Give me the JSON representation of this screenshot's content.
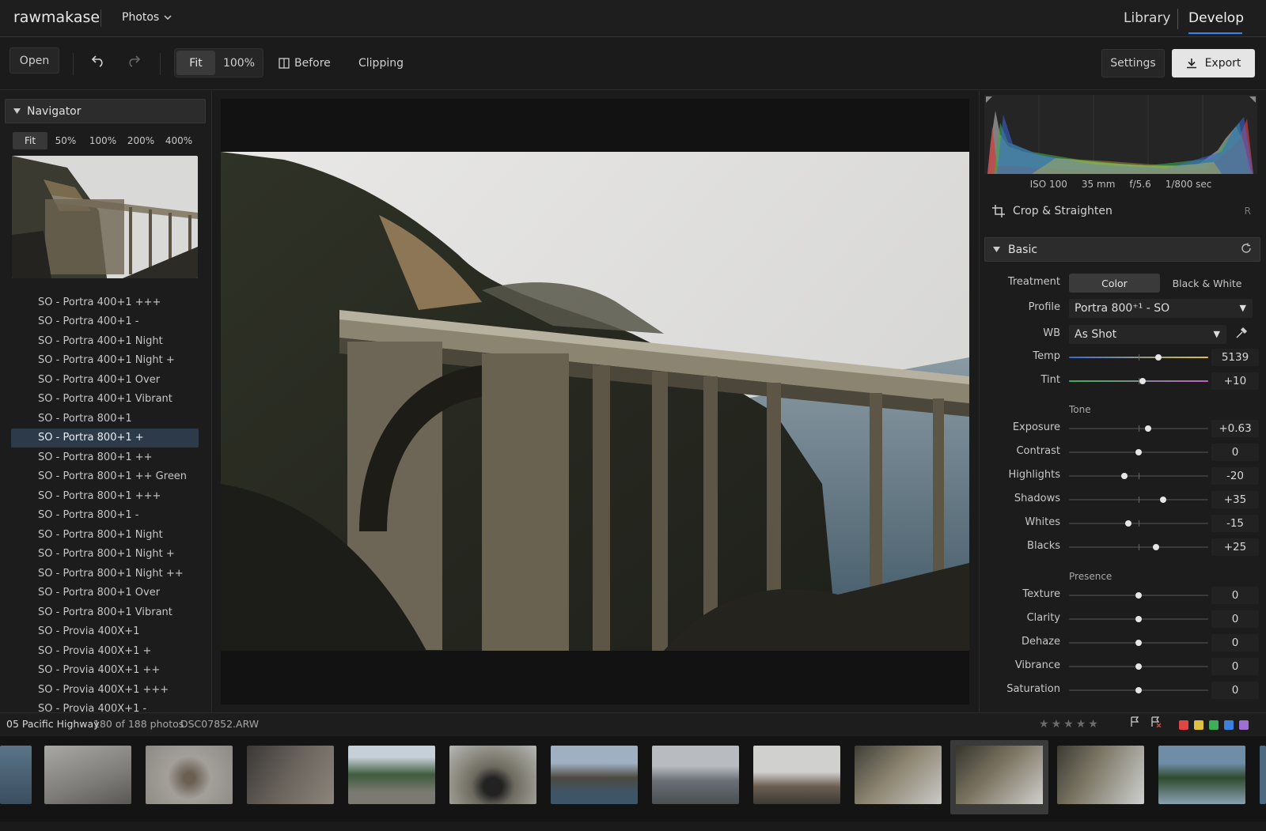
{
  "app": {
    "brand": "rawmakase",
    "album_dropdown": "Photos",
    "modes": [
      "Library",
      "Develop"
    ],
    "active_mode": "Develop"
  },
  "toolbar": {
    "open": "Open",
    "fit": "Fit",
    "zoom100": "100%",
    "before": "Before",
    "clipping": "Clipping",
    "settings": "Settings",
    "export": "Export"
  },
  "navigator": {
    "title": "Navigator",
    "zoom_levels": [
      "Fit",
      "50%",
      "100%",
      "200%",
      "400%"
    ],
    "active_zoom": "Fit"
  },
  "presets": [
    "SO - Portra 400+1 +++",
    "SO - Portra 400+1 -",
    "SO - Portra 400+1 Night",
    "SO - Portra 400+1 Night +",
    "SO - Portra 400+1 Over",
    "SO - Portra 400+1 Vibrant",
    "SO - Portra 800+1",
    "SO - Portra 800+1 +",
    "SO - Portra 800+1 ++",
    "SO - Portra 800+1 ++ Green",
    "SO - Portra 800+1 +++",
    "SO - Portra 800+1 -",
    "SO - Portra 800+1 Night",
    "SO - Portra 800+1 Night +",
    "SO - Portra 800+1 Night ++",
    "SO - Portra 800+1 Over",
    "SO - Portra 800+1 Vibrant",
    "SO - Provia 400X+1",
    "SO - Provia 400X+1 +",
    "SO - Provia 400X+1 ++",
    "SO - Provia 400X+1 +++",
    "SO - Provia 400X+1 -"
  ],
  "selected_preset": "SO - Portra 800+1 +",
  "exif": {
    "iso": "ISO 100",
    "focal": "35 mm",
    "aperture": "f/5.6",
    "shutter": "1/800 sec"
  },
  "crop": {
    "label": "Crop & Straighten",
    "shortcut": "R"
  },
  "basic": {
    "title": "Basic",
    "treatment_label": "Treatment",
    "treatment_options": [
      "Color",
      "Black & White"
    ],
    "treatment_selected": "Color",
    "profile_label": "Profile",
    "profile_value": "Portra 800⁺¹ - SO",
    "wb_label": "WB",
    "wb_value": "As Shot",
    "tone_section": "Tone",
    "presence_section": "Presence",
    "sliders": {
      "temp": {
        "label": "Temp",
        "value": "5139",
        "position": 0.64
      },
      "tint": {
        "label": "Tint",
        "value": "+10",
        "position": 0.53
      },
      "exposure": {
        "label": "Exposure",
        "value": "+0.63",
        "position": 0.57
      },
      "contrast": {
        "label": "Contrast",
        "value": "0",
        "position": 0.5
      },
      "highlights": {
        "label": "Highlights",
        "value": "-20",
        "position": 0.4
      },
      "shadows": {
        "label": "Shadows",
        "value": "+35",
        "position": 0.675
      },
      "whites": {
        "label": "Whites",
        "value": "-15",
        "position": 0.425
      },
      "blacks": {
        "label": "Blacks",
        "value": "+25",
        "position": 0.625
      },
      "texture": {
        "label": "Texture",
        "value": "0",
        "position": 0.5
      },
      "clarity": {
        "label": "Clarity",
        "value": "0",
        "position": 0.5
      },
      "dehaze": {
        "label": "Dehaze",
        "value": "0",
        "position": 0.5
      },
      "vibrance": {
        "label": "Vibrance",
        "value": "0",
        "position": 0.5
      },
      "saturation": {
        "label": "Saturation",
        "value": "0",
        "position": 0.5
      }
    }
  },
  "status": {
    "album": "05 Pacific Highway",
    "count": "180 of 188 photos",
    "filename": "DSC07852.ARW"
  },
  "color_labels": [
    "#e04545",
    "#e0c040",
    "#3fae5a",
    "#3b82e0",
    "#a070d0"
  ],
  "colors": {
    "accent": "#3b82f6",
    "selection": "#2c3a4a"
  }
}
